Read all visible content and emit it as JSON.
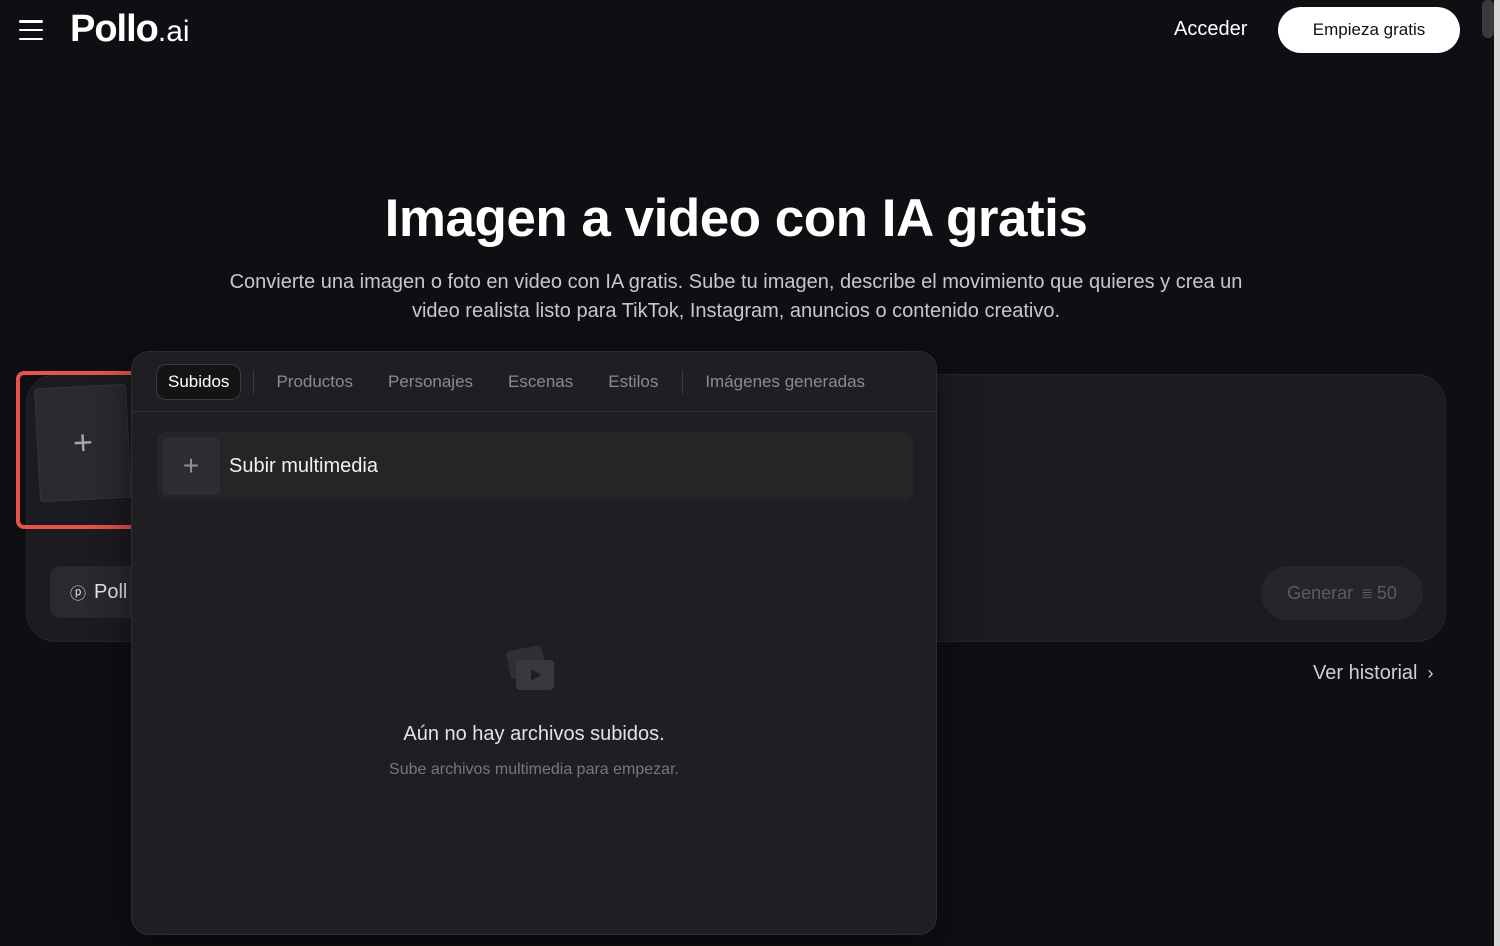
{
  "header": {
    "menu_icon": "hamburger-menu-icon",
    "logo_main": "Pollo",
    "logo_suffix": ".ai",
    "signin_label": "Acceder",
    "cta_label": "Empieza gratis"
  },
  "hero": {
    "title": "Imagen a video con IA gratis",
    "subtitle": "Convierte una imagen o foto en video con IA gratis. Sube tu imagen, describe el movimiento que quieres y crea un video realista listo para TikTok, Instagram, anuncios o contenido creativo."
  },
  "generator": {
    "upload_icon": "plus-icon",
    "model_label": "Poll",
    "generate_label": "Generar",
    "generate_cost": "50",
    "history_label": "Ver historial"
  },
  "media_panel": {
    "tabs": [
      {
        "label": "Subidos",
        "active": true
      },
      {
        "label": "Productos"
      },
      {
        "label": "Personajes"
      },
      {
        "label": "Escenas"
      },
      {
        "label": "Estilos"
      },
      {
        "label": "Imágenes generadas"
      }
    ],
    "upload_label": "Subir multimedia",
    "empty_title": "Aún no hay archivos subidos.",
    "empty_subtitle": "Sube archivos multimedia para empezar."
  },
  "colors": {
    "background": "#0f0f13",
    "panel": "#1f1f23",
    "highlight": "#e5534b",
    "cta_bg": "#ffffff"
  }
}
